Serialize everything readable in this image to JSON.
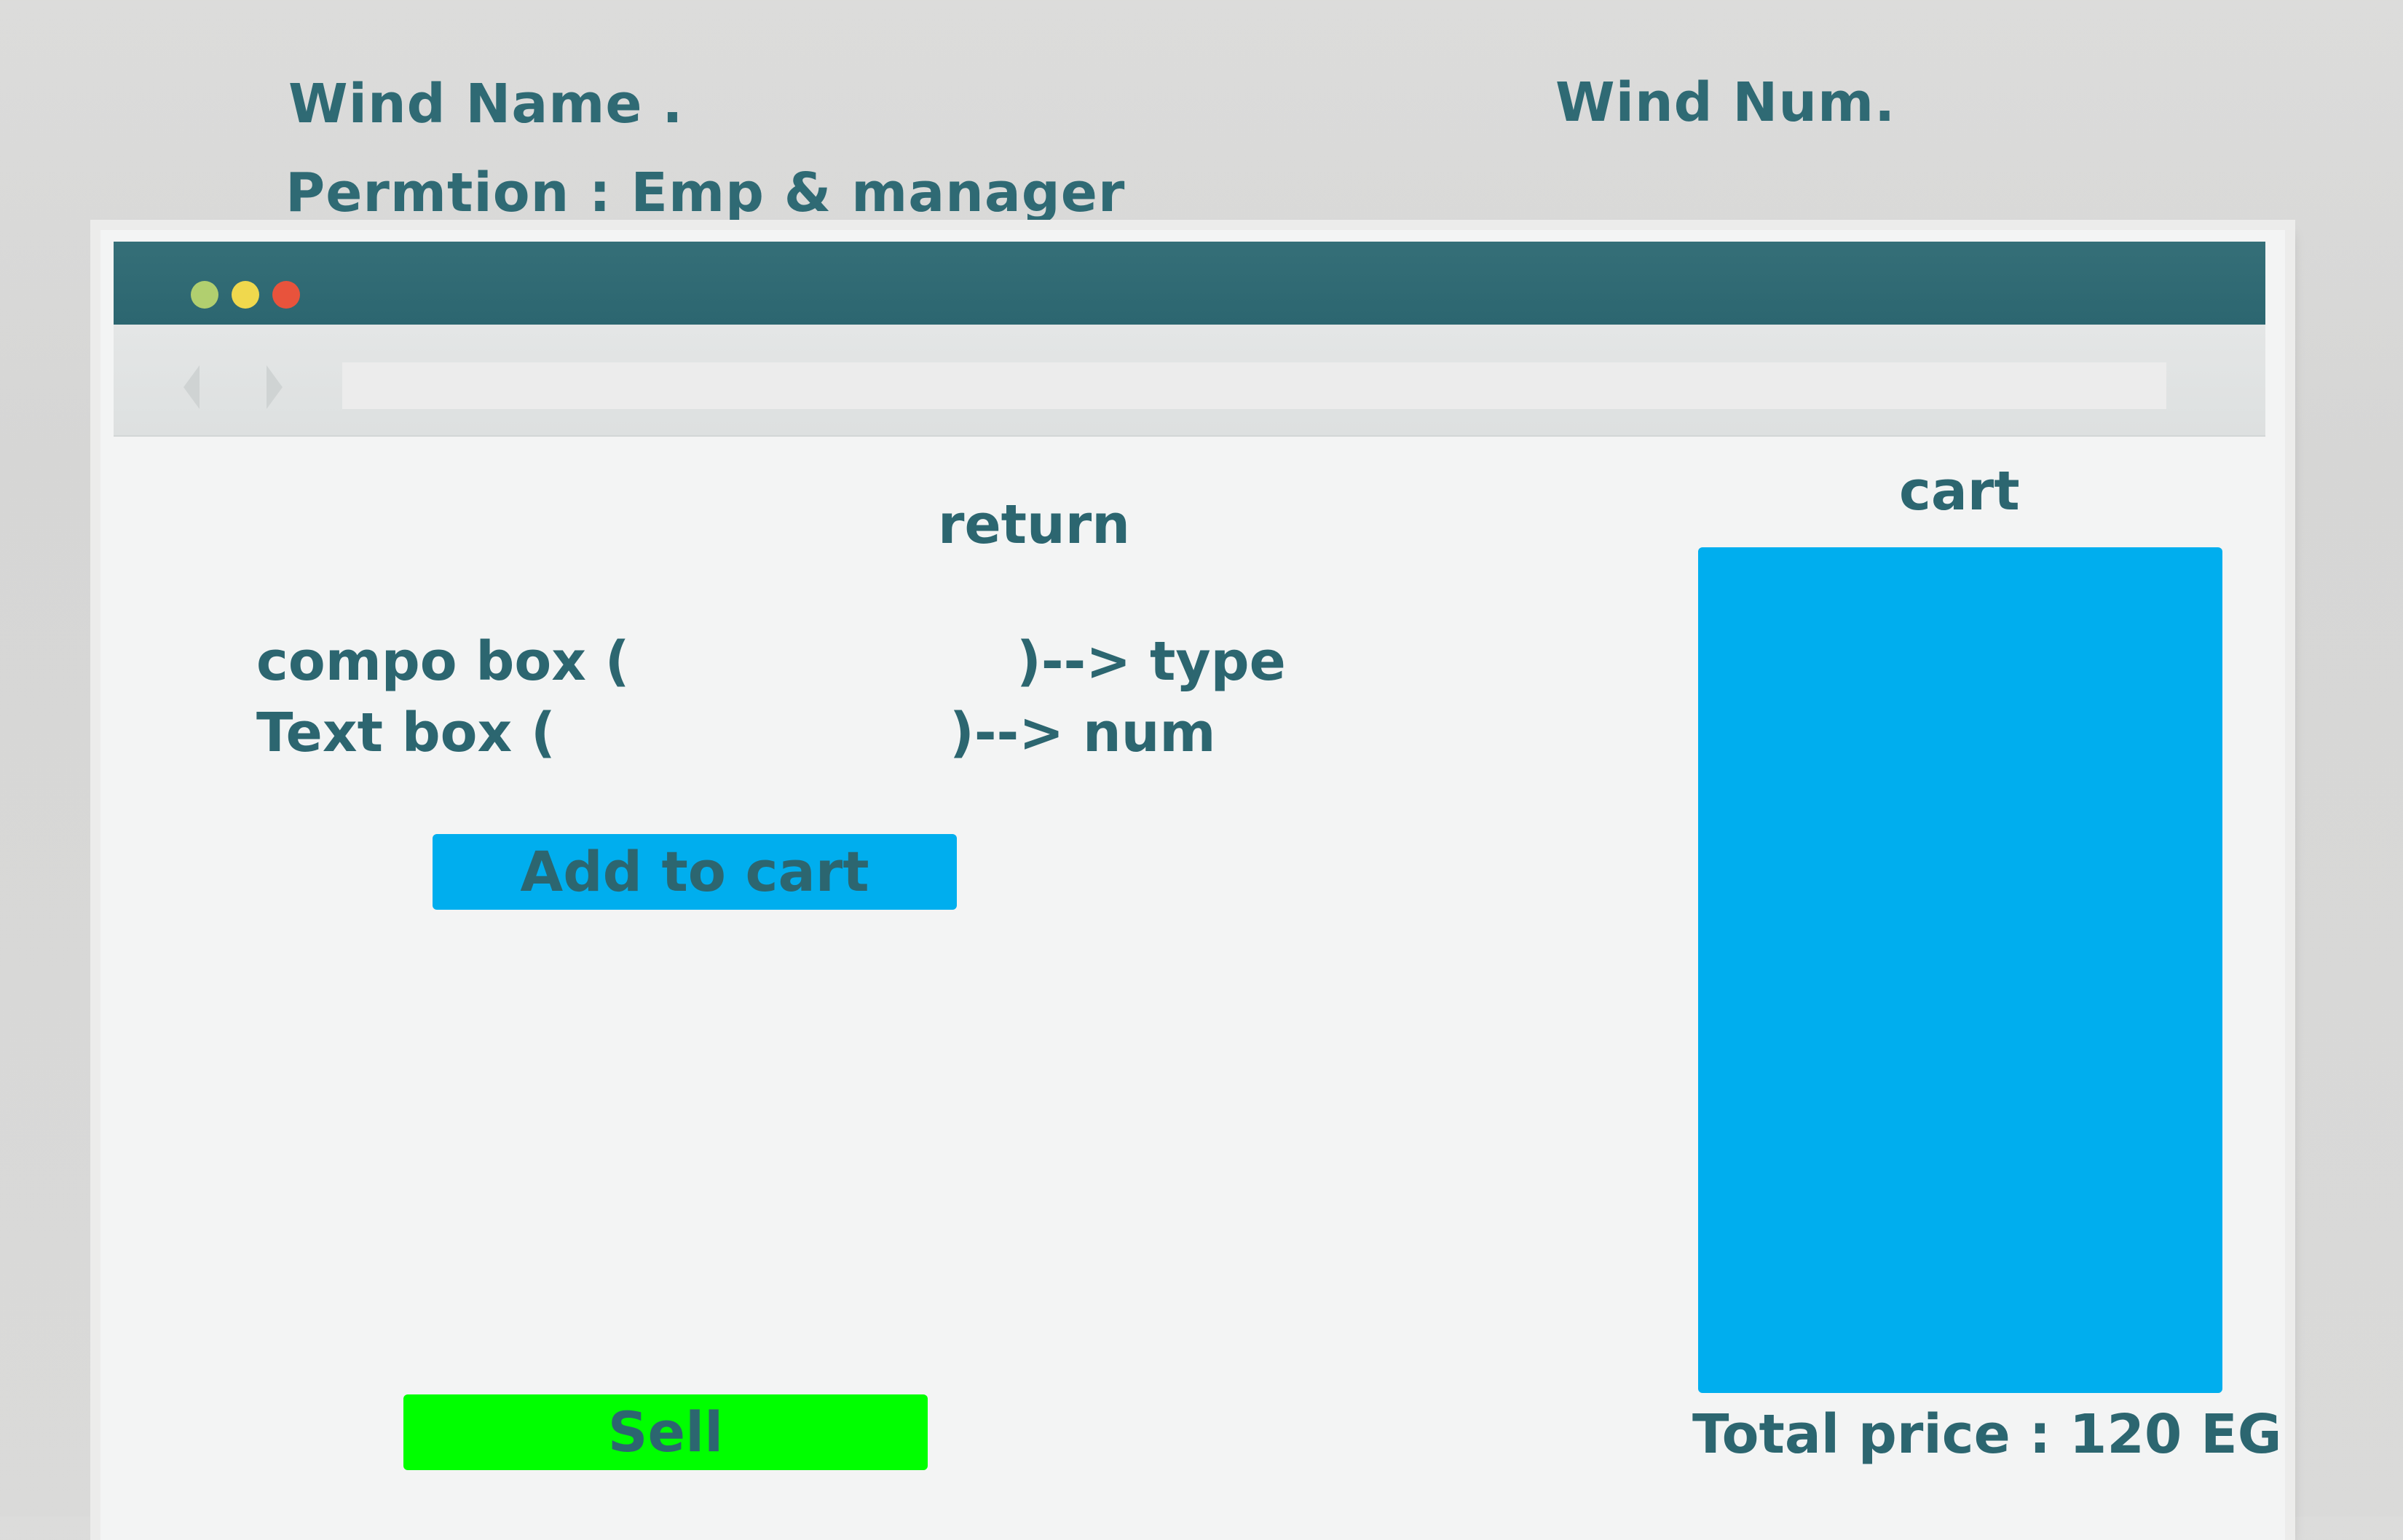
{
  "header": {
    "wind_name": "Wind Name .",
    "wind_num": "Wind Num.",
    "permission": "Permtion : Emp & manager"
  },
  "window": {
    "controls": [
      "close-dot-green",
      "minimize-dot-yellow",
      "maximize-dot-red"
    ],
    "colors": {
      "titlebar": "#2f6a74",
      "accent_blue": "#00aeee",
      "accent_green": "#00ff00",
      "text": "#2c6670"
    }
  },
  "main": {
    "title": "return",
    "combo_prefix": "compo box (",
    "combo_suffix": ")--> type",
    "text_prefix": "Text box (",
    "text_suffix": ")--> num",
    "add_to_cart_label": "Add to cart",
    "sell_label": "Sell"
  },
  "cart": {
    "title": "cart",
    "total_label": "Total price : 120 EG"
  }
}
